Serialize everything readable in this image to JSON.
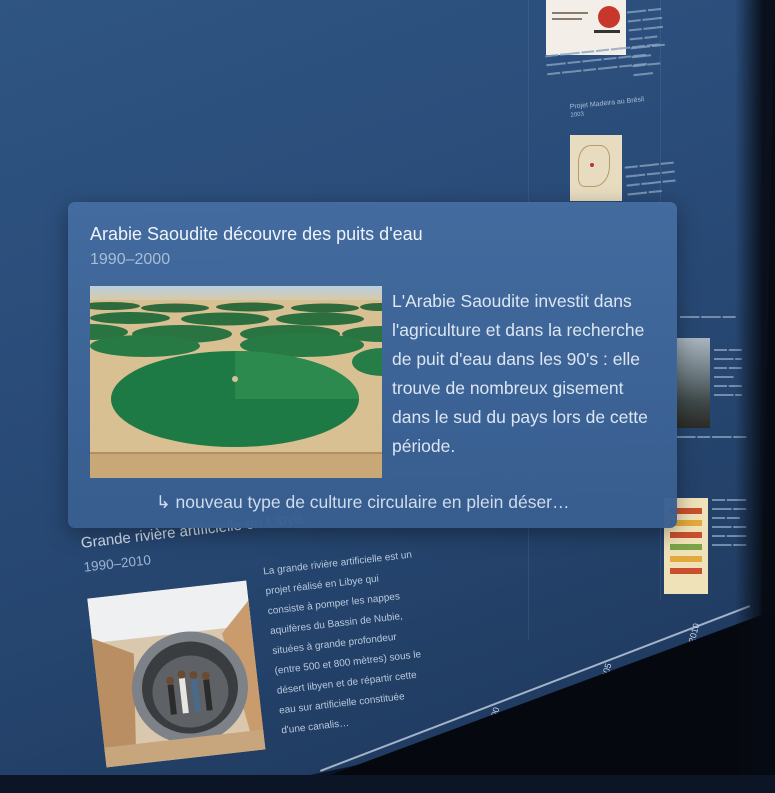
{
  "focused_event": {
    "title": "Arabie Saoudite découvre des puits d'eau",
    "date": "1990–2000",
    "description": "L'Arabie Saoudite investit dans l'agriculture et dans la recherche de puit d'eau dans les 90's : elle trouve de nombreux gisement dans le sud du pays lors de cette période.",
    "more": "↳ nouveau type de culture circulaire en plein déser…",
    "image": "circular-irrigation-fields-photo"
  },
  "background_events": [
    {
      "title": "Grande rivière artificielle en Libye",
      "date": "1990–2010",
      "description": "La grande rivière artificielle est un projet réalisé en Libye qui consiste à pomper les nappes aquifères du Bassin de Nubie, situées à grande profondeur (entre 500 et 800 mètres) sous le désert libyen et de répartir cette eau sur artificielle constituée d'une canalis…",
      "image": "pipeline-tunnel-photo"
    },
    {
      "title": "Projet Madeira au Brésil",
      "date": "2003",
      "image": "map-thumbnail"
    }
  ],
  "timeline_axis": {
    "labels": [
      "2000",
      "2005",
      "2010"
    ]
  },
  "colors": {
    "background": "#2a4c79",
    "card": "#466ea0",
    "text": "#dce6f2"
  }
}
